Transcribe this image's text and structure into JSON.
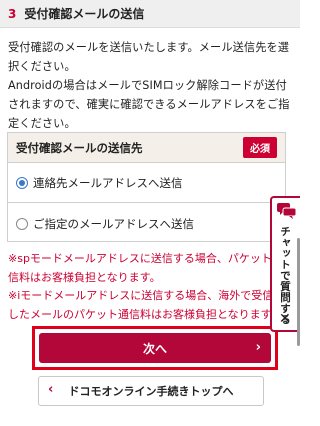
{
  "section": {
    "number": "3",
    "title": "受付確認メールの送信"
  },
  "intro": {
    "line1": "受付確認のメールを送信いたします。メール送信先を選",
    "line2": "択ください。",
    "line3": "Androidの場合はメールでSIMロック解除コードが送付",
    "line4": "されますので、確実に確認できるメールアドレスをご指",
    "line5": "定ください。"
  },
  "destination": {
    "label": "受付確認メールの送信先",
    "required_badge": "必須",
    "options": [
      {
        "label": "連絡先メールアドレスへ送信",
        "selected": true
      },
      {
        "label": "ご指定のメールアドレスへ送信",
        "selected": false
      }
    ]
  },
  "notes": {
    "line1": "※spモードメールアドレスに送信する場合、パケット通",
    "line2": "信料はお客様負担となります。",
    "line3": "※iモードメールアドレスに送信する場合、海外で受信",
    "line4": "したメールのパケット通信料はお客様負担となります。"
  },
  "buttons": {
    "next_label": "次へ",
    "next_chevron": "›",
    "top_label": "ドコモオンライン手続きトップへ",
    "top_chevron": "‹"
  },
  "chat": {
    "label": "チャットで質問する",
    "close": "✕"
  },
  "colors": {
    "accent": "#b3073a",
    "alert": "#cc0033",
    "highlight": "#e0001a",
    "radio": "#3a78c8"
  }
}
